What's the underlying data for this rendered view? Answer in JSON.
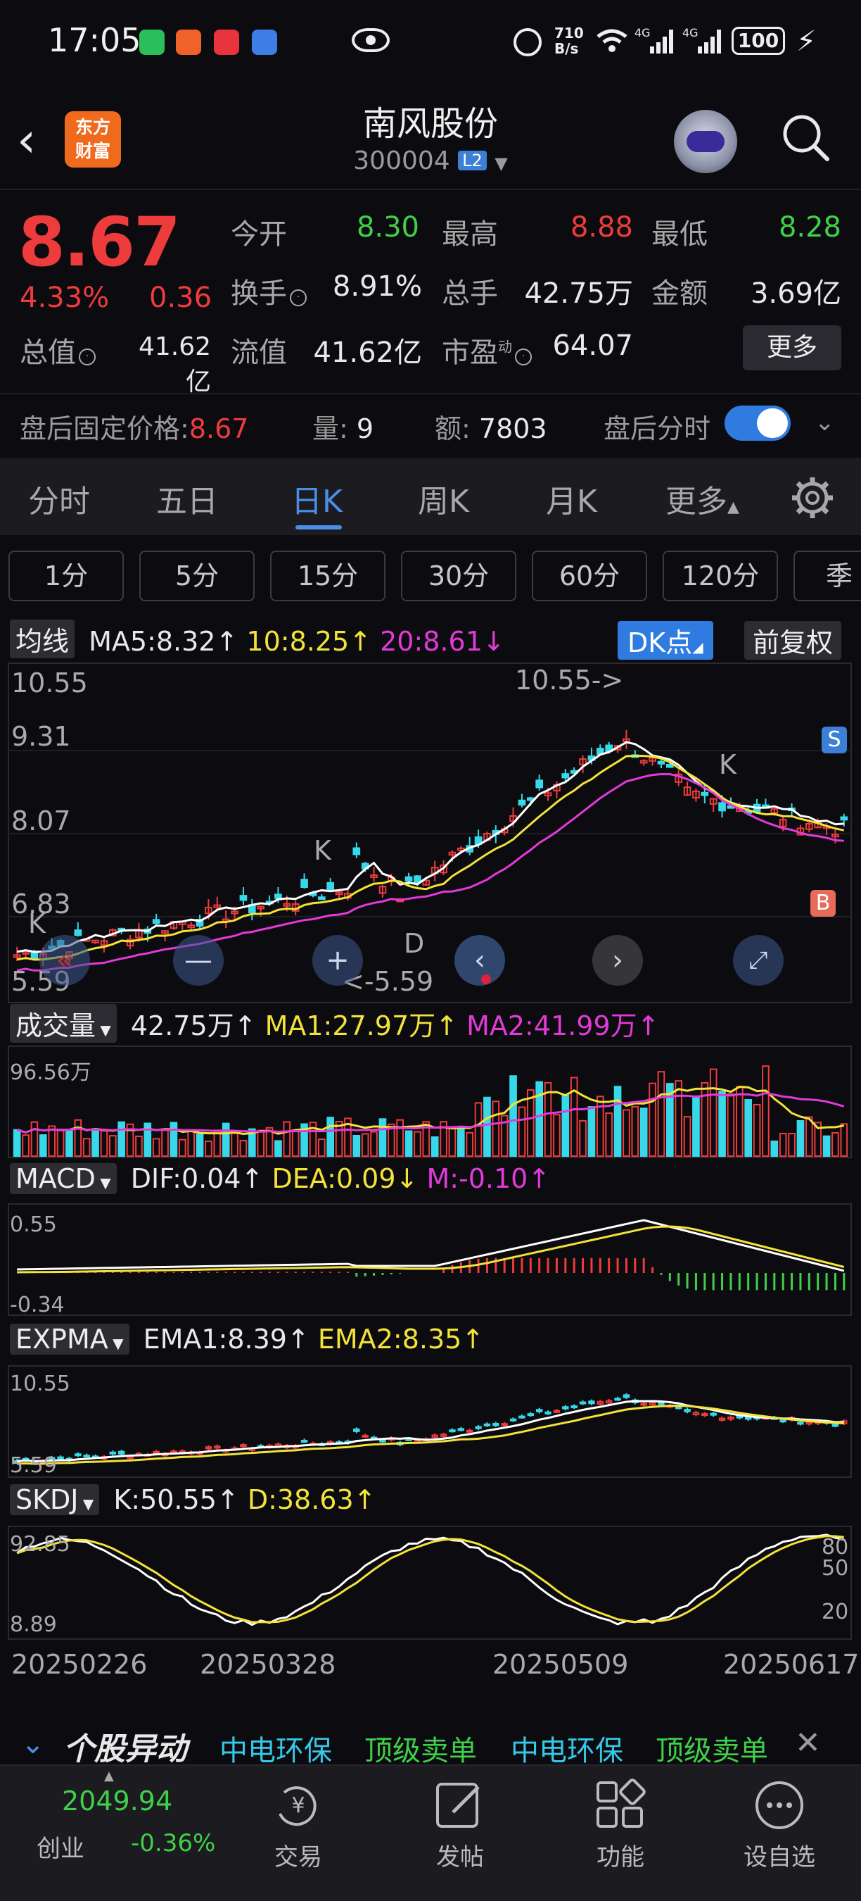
{
  "status_bar": {
    "time": "17:05",
    "net_speed_top": "710",
    "net_speed_bottom": "B/s",
    "battery": "100"
  },
  "header": {
    "logo_line1": "东方",
    "logo_line2": "财富",
    "stock_name": "南风股份",
    "stock_code": "300004",
    "badge": "L2"
  },
  "quote": {
    "price": "8.67",
    "change_pct": "4.33%",
    "change": "0.36",
    "open_label": "今开",
    "open": "8.30",
    "high_label": "最高",
    "high": "8.88",
    "low_label": "最低",
    "low": "8.28",
    "turnover_label": "换手",
    "turnover": "8.91%",
    "volume_label": "总手",
    "volume": "42.75万",
    "amount_label": "金额",
    "amount": "3.69亿",
    "mcap_label": "总值",
    "mcap": "41.62亿",
    "float_label": "流值",
    "float": "41.62亿",
    "pe_label": "市盈",
    "pe_sup": "动",
    "pe": "64.07",
    "more_label": "更多"
  },
  "after_hours": {
    "price_label": "盘后固定价格:",
    "price": "8.67",
    "vol_label": "量:",
    "vol": "9",
    "amt_label": "额:",
    "amt": "7803",
    "toggle_label": "盘后分时",
    "toggle_on": true
  },
  "tabs": [
    "分时",
    "五日",
    "日K",
    "周K",
    "月K",
    "更多"
  ],
  "active_tab": "日K",
  "minute_buttons": [
    "1分",
    "5分",
    "15分",
    "30分",
    "60分",
    "120分",
    "季"
  ],
  "ma_row": {
    "selector": "均线",
    "ma5": "MA5:8.32↑",
    "ma10": "10:8.25↑",
    "ma20": "20:8.61↓",
    "dk_label": "DK点",
    "fq_label": "前复权"
  },
  "kline": {
    "y_labels": [
      "10.55",
      "9.31",
      "8.07",
      "6.83",
      "5.59"
    ],
    "high_marker": "10.55->",
    "low_marker": "<-5.59",
    "signals": {
      "k": "K",
      "d": "D",
      "s": "S",
      "b": "B"
    }
  },
  "volume_row": {
    "selector": "成交量",
    "vol": "42.75万↑",
    "ma1": "MA1:27.97万↑",
    "ma2": "MA2:41.99万↑",
    "y_top": "96.56万"
  },
  "macd_row": {
    "selector": "MACD",
    "dif": "DIF:0.04↑",
    "dea": "DEA:0.09↓",
    "m": "M:-0.10↑",
    "y_top": "0.55",
    "y_bottom": "-0.34"
  },
  "expma_row": {
    "selector": "EXPMA",
    "ema1": "EMA1:8.39↑",
    "ema2": "EMA2:8.35↑",
    "y_top": "10.55",
    "y_bottom": "5.59"
  },
  "skdj_row": {
    "selector": "SKDJ",
    "k": "K:50.55↑",
    "d": "D:38.63↑",
    "y_top": "92.85",
    "y_bottom": "8.89",
    "y_right": [
      "80",
      "50",
      "20"
    ]
  },
  "dates": [
    "20250226",
    "20250328",
    "20250509",
    "20250617"
  ],
  "ticker": {
    "title": "个股异动",
    "items": [
      "中电环保",
      "顶级卖单",
      "中电环保",
      "顶级卖单"
    ]
  },
  "bottom_nav": {
    "index_value": "2049.94",
    "index_name": "创业",
    "index_change": "-0.36%",
    "items": [
      "交易",
      "发帖",
      "功能",
      "设自选"
    ]
  },
  "colors": {
    "up": "#ee3b3b",
    "down": "#36d8ea",
    "ma5": "#ffffff",
    "ma10": "#f2e23a",
    "ma20": "#e23ad8",
    "accent": "#2f7be0"
  }
}
